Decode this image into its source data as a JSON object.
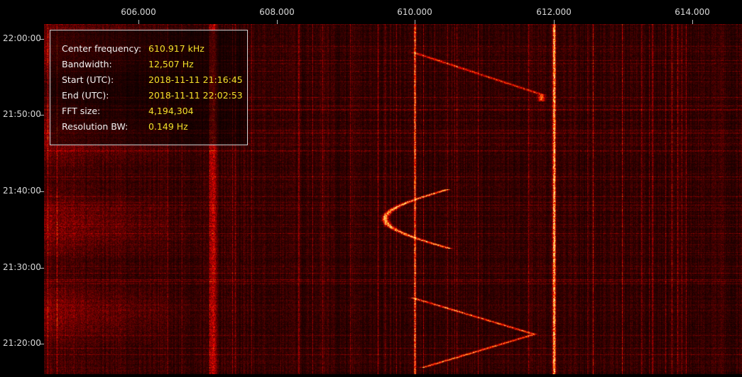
{
  "frequency_axis": {
    "ticks": [
      "606.000",
      "608.000",
      "610.000",
      "612.000",
      "614.000"
    ]
  },
  "time_axis": {
    "ticks": [
      "22:00:00",
      "21:50:00",
      "21:40:00",
      "21:30:00",
      "21:20:00"
    ]
  },
  "info_panel": {
    "rows": [
      {
        "key": "Center frequency:",
        "value": "610.917 kHz"
      },
      {
        "key": "Bandwidth:",
        "value": "12,507 Hz"
      },
      {
        "key": "Start (UTC):",
        "value": "2018-11-11 21:16:45"
      },
      {
        "key": "End (UTC):",
        "value": "2018-11-11 22:02:53"
      },
      {
        "key": "FFT size:",
        "value": "4,194,304"
      },
      {
        "key": "Resolution BW:",
        "value": "0.149 Hz"
      }
    ]
  },
  "colors": {
    "background": "#000000",
    "heat_low": "#3a0000",
    "heat_mid": "#e0200a",
    "heat_high": "#ffe080",
    "info_value": "#f3e12a"
  }
}
